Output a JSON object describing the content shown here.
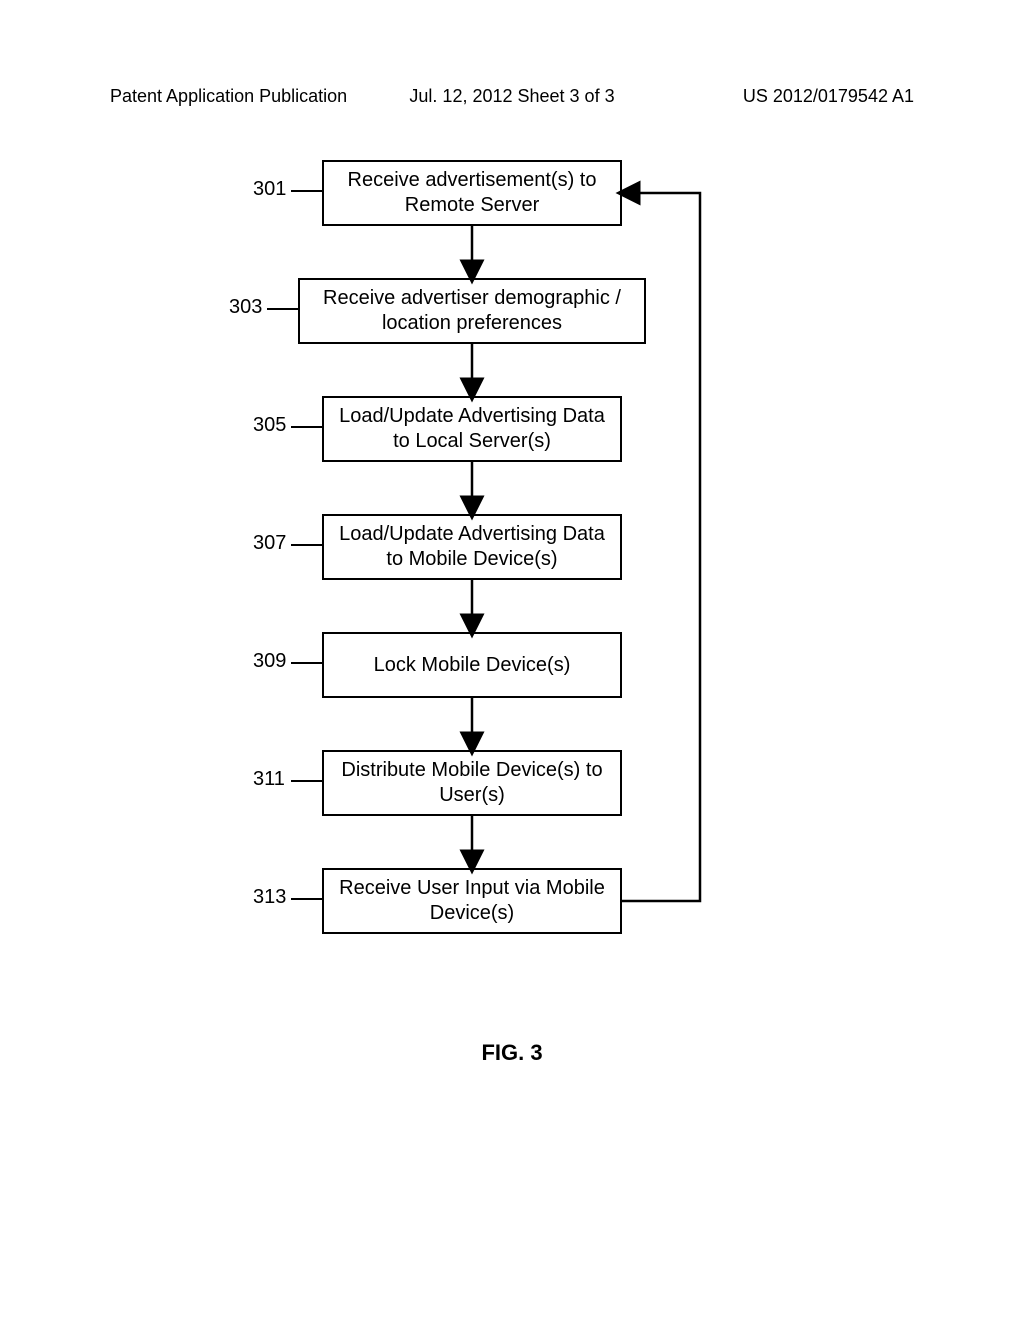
{
  "header": {
    "left": "Patent Application Publication",
    "center": "Jul. 12, 2012  Sheet 3 of 3",
    "right": "US 2012/0179542 A1"
  },
  "figure_label": "FIG. 3",
  "boxes": [
    {
      "ref": "301",
      "text": "Receive advertisement(s) to Remote Server"
    },
    {
      "ref": "303",
      "text": "Receive advertiser demographic / location preferences"
    },
    {
      "ref": "305",
      "text": "Load/Update Advertising Data to Local Server(s)"
    },
    {
      "ref": "307",
      "text": "Load/Update Advertising Data to Mobile Device(s)"
    },
    {
      "ref": "309",
      "text": "Lock Mobile Device(s)"
    },
    {
      "ref": "311",
      "text": "Distribute Mobile Device(s) to User(s)"
    },
    {
      "ref": "313",
      "text": "Receive User Input via Mobile Device(s)"
    }
  ]
}
